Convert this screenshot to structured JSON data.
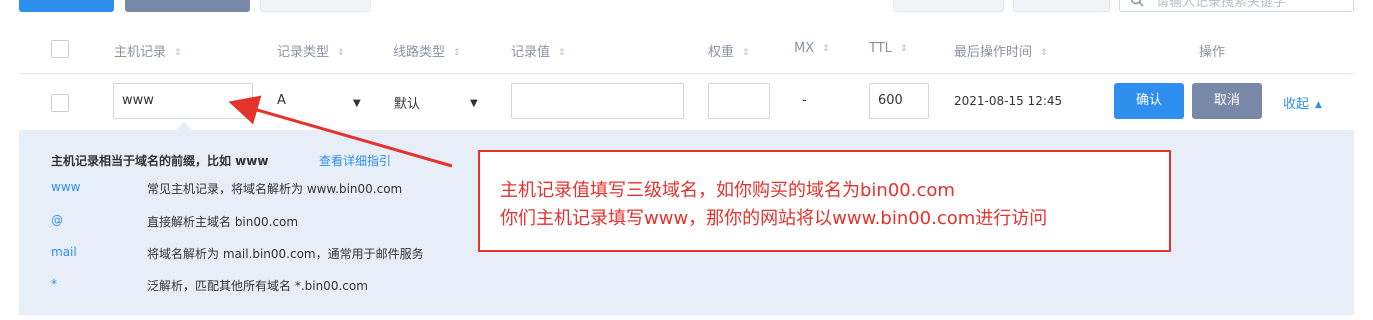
{
  "toolbar": {
    "search_placeholder": "请输入记录搜索关键字"
  },
  "table": {
    "headers": {
      "host": "主机记录",
      "type": "记录类型",
      "line": "线路类型",
      "value": "记录值",
      "weight": "权重",
      "mx": "MX",
      "ttl": "TTL",
      "updated": "最后操作时间",
      "actions": "操作"
    }
  },
  "edit_row": {
    "host": "www",
    "type": "A",
    "line": "默认",
    "value": "",
    "weight": "",
    "mx": "-",
    "ttl": "600",
    "updated": "2021-08-15 12:45",
    "confirm": "确认",
    "cancel": "取消",
    "collapse": "收起"
  },
  "help": {
    "title": "主机记录相当于域名的前缀，比如 www",
    "link": "查看详细指引",
    "items": [
      {
        "key": "www",
        "desc": "常见主机记录，将域名解析为 www.bin00.com"
      },
      {
        "key": "@",
        "desc": "直接解析主域名 bin00.com"
      },
      {
        "key": "mail",
        "desc": "将域名解析为 mail.bin00.com，通常用于邮件服务"
      },
      {
        "key": "*",
        "desc": "泛解析，匹配其他所有域名 *.bin00.com"
      }
    ]
  },
  "annotation": {
    "line1": "主机记录值填写三级域名，如你购买的域名为bin00.com",
    "line2": "你们主机记录填写www，那你的网站将以www.bin00.com进行访问"
  },
  "colors": {
    "primary": "#2f8fef",
    "secondary": "#7888a6",
    "annotation": "#e5322d",
    "panel": "#e8eef8"
  },
  "icons": {
    "sort": "sort-icon",
    "search": "search-icon",
    "caret": "caret-down-icon",
    "collapse": "caret-up-icon"
  }
}
